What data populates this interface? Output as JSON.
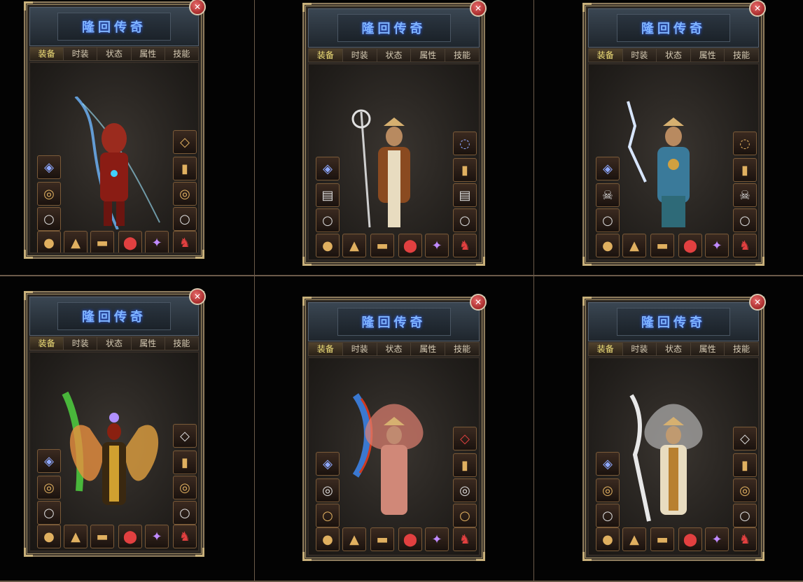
{
  "panels": [
    {
      "title": "隆回传奇",
      "tabs": [
        "装备",
        "时装",
        "状态",
        "属性",
        "技能"
      ],
      "active_tab": 0,
      "theme": "lightning"
    },
    {
      "title": "隆回传奇",
      "tabs": [
        "装备",
        "时装",
        "状态",
        "属性",
        "技能"
      ],
      "active_tab": 0,
      "theme": "monk"
    },
    {
      "title": "隆回传奇",
      "tabs": [
        "装备",
        "时装",
        "状态",
        "属性",
        "技能"
      ],
      "active_tab": 0,
      "theme": "monk-cyan"
    },
    {
      "title": "隆回传奇",
      "tabs": [
        "装备",
        "时装",
        "状态",
        "属性",
        "技能"
      ],
      "active_tab": 0,
      "theme": "wings"
    },
    {
      "title": "隆回传奇",
      "tabs": [
        "装备",
        "时装",
        "状态",
        "属性",
        "技能"
      ],
      "active_tab": 0,
      "theme": "pink"
    },
    {
      "title": "隆回传奇",
      "tabs": [
        "装备",
        "时装",
        "状态",
        "属性",
        "技能"
      ],
      "active_tab": 0,
      "theme": "white"
    }
  ],
  "close_glyph": "✕",
  "icons": {
    "left_slots": [
      "helmet-icon",
      "ring-icon",
      "bracelet-icon"
    ],
    "right_slots": [
      "necklace-icon",
      "armguard-icon",
      "ring-icon",
      "ring-icon"
    ],
    "bottom_slots": [
      "medicine-icon",
      "boots-icon",
      "belt-icon",
      "charm-icon",
      "gem-icon",
      "mount-icon"
    ]
  },
  "colors": {
    "title_text": "#7fb4ff",
    "active_tab": "#f3e27a",
    "tab_text": "#d6cbb4",
    "panel_border": "#8c7a5c",
    "grid_line": "#6b5a4a",
    "close_button": "#b01818"
  }
}
